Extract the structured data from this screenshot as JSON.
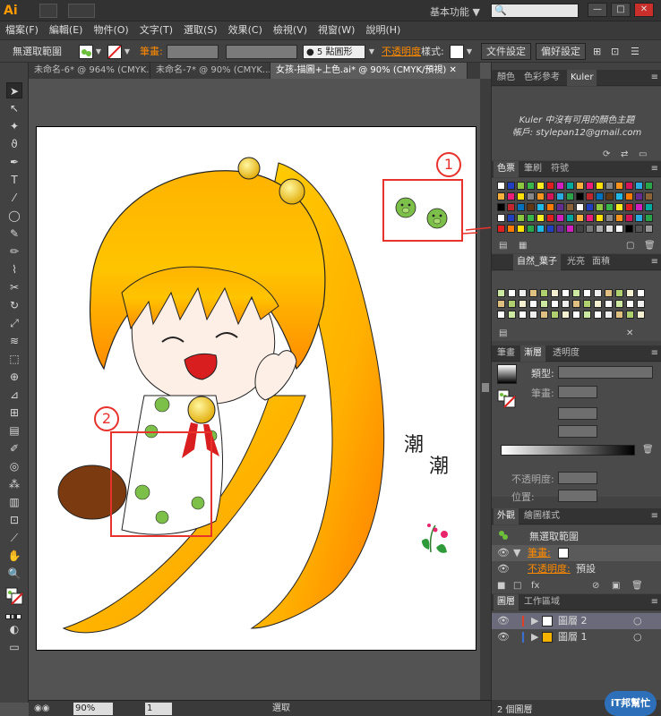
{
  "app": {
    "logo": "Ai",
    "workspace": "基本功能",
    "workspace_arrow": "▼",
    "search_icon": "🔍"
  },
  "window_buttons": [
    "—",
    "□",
    "✕"
  ],
  "menu": [
    "檔案(F)",
    "編輯(E)",
    "物件(O)",
    "文字(T)",
    "選取(S)",
    "效果(C)",
    "檢視(V)",
    "視窗(W)",
    "說明(H)"
  ],
  "control": {
    "selection_label": "無選取範圍",
    "stroke_label": "筆畫:",
    "brush_label": "● 5 點圓形",
    "opacity_label": "不透明度",
    "style_label": "樣式:",
    "doc_setup_button": "文件設定",
    "prefs_button": "偏好設定"
  },
  "doc_tabs": [
    {
      "label": "未命名-6* @ 964% (CMYK...",
      "close": "✕"
    },
    {
      "label": "未命名-7* @ 90% (CMYK...",
      "close": "✕"
    },
    {
      "label": "女孩-描圖+上色.ai* @ 90% (CMYK/預視)",
      "close": "✕"
    }
  ],
  "status": {
    "zoom": "90%",
    "page": "1",
    "mode": "選取"
  },
  "panels": {
    "color_tabs": [
      "顏色",
      "色彩參考",
      "Kuler"
    ],
    "kuler_message": "Kuler 中沒有可用的顏色主題",
    "kuler_account": "帳戶: stylepan12@gmail.com",
    "swatch_tabs": [
      "色票",
      "筆刷",
      "符號"
    ],
    "pattern_tabs": [
      "自然_葉子",
      "光亮",
      "面積"
    ],
    "gradient_tabs": [
      "筆畫",
      "漸層",
      "透明度"
    ],
    "gradient_type_label": "類型:",
    "gradient_stroke_label": "筆畫:",
    "gradient_opacity_label": "不透明度:",
    "gradient_position_label": "位置:",
    "appearance_tabs": [
      "外觀",
      "繪圖樣式"
    ],
    "appearance_title": "無選取範圍",
    "appearance_stroke": "筆畫:",
    "appearance_opacity": "不透明度:",
    "appearance_opacity_value": "預設",
    "layers_tabs": [
      "圖層",
      "工作區域"
    ],
    "layers": [
      "圖層 2",
      "圖層 1"
    ],
    "layers_footer": "2 個圖層"
  },
  "artwork": {
    "annotation_1": "1",
    "annotation_2": "2",
    "text_1": "潮",
    "text_2": "潮"
  },
  "watermark": "iT邦幫忙"
}
